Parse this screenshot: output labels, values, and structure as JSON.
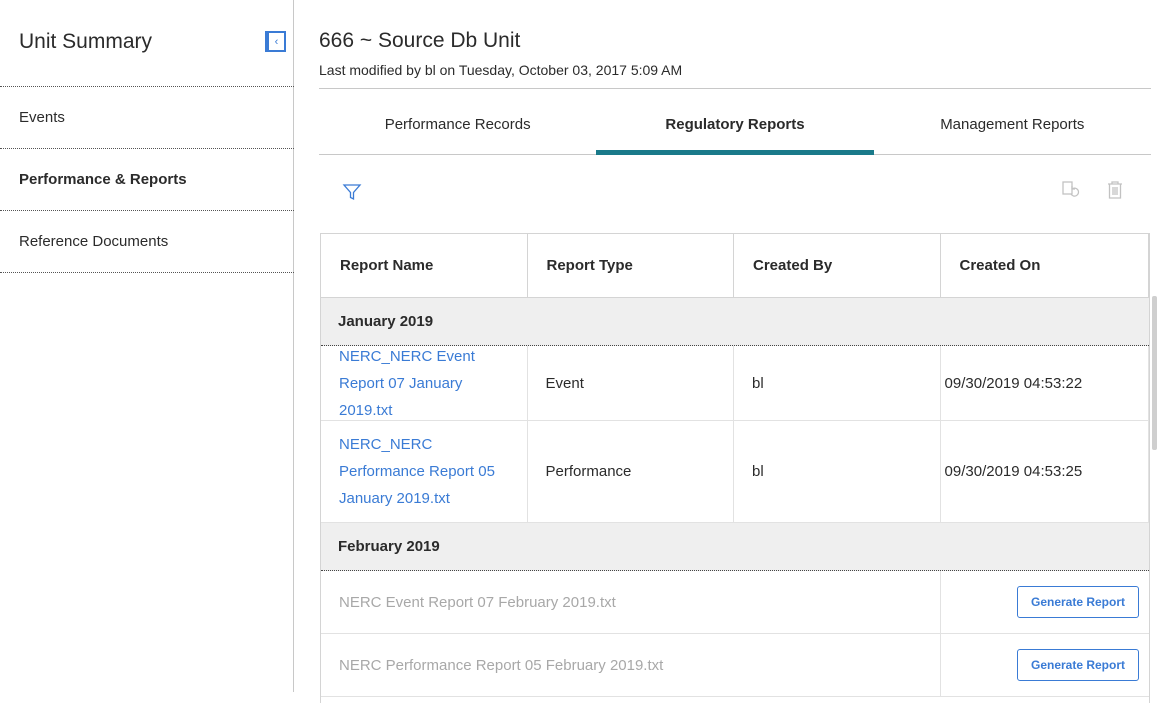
{
  "sidebar": {
    "title": "Unit Summary",
    "items": [
      {
        "label": "Events"
      },
      {
        "label": "Performance & Reports"
      },
      {
        "label": "Reference Documents"
      }
    ]
  },
  "header": {
    "title": "666 ~ Source Db Unit",
    "modified": "Last modified by bl on Tuesday, October 03, 2017 5:09 AM"
  },
  "tabs": [
    {
      "label": "Performance Records"
    },
    {
      "label": "Regulatory Reports"
    },
    {
      "label": "Management Reports"
    }
  ],
  "toolbar": {
    "icons": [
      "filter-icon",
      "copy-refresh-icon",
      "trash-icon"
    ]
  },
  "table": {
    "columns": [
      "Report Name",
      "Report Type",
      "Created By",
      "Created On"
    ],
    "groups": [
      {
        "label": "January 2019",
        "rows": [
          {
            "name": "NERC_NERC Event Report 07 January 2019.txt",
            "type": "Event",
            "created_by": "bl",
            "created_on": "09/30/2019 04:53:22"
          },
          {
            "name": "NERC_NERC Performance Report 05 January 2019.txt",
            "type": "Performance",
            "created_by": "bl",
            "created_on": "09/30/2019 04:53:25"
          }
        ]
      },
      {
        "label": "February 2019",
        "pending": [
          {
            "name": "NERC Event Report 07 February 2019.txt",
            "action": "Generate Report"
          },
          {
            "name": "NERC Performance Report 05 February 2019.txt",
            "action": "Generate Report"
          }
        ]
      }
    ]
  },
  "colors": {
    "accent": "#1a7a8a",
    "link": "#3a7bd5",
    "group_bg": "#efefef"
  }
}
